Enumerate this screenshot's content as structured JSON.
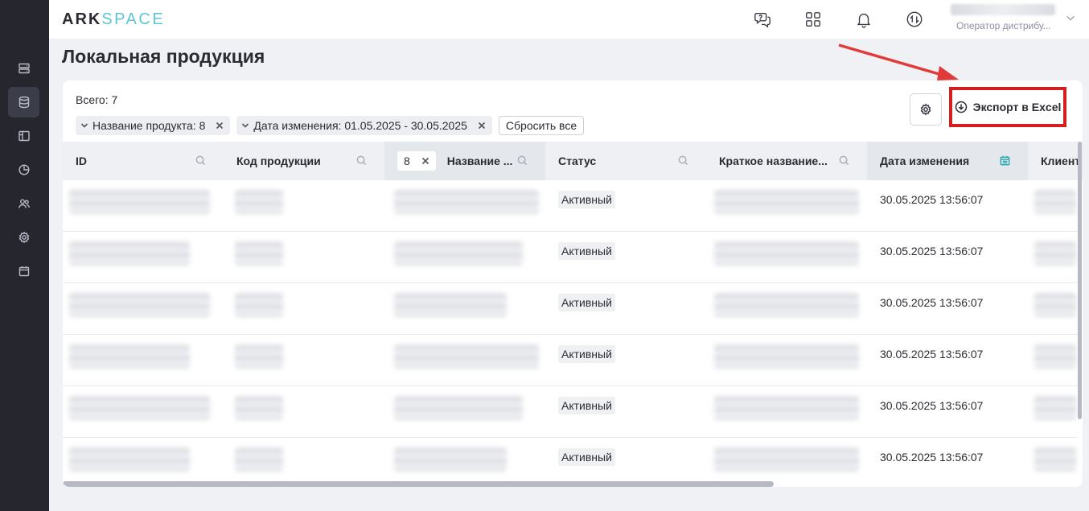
{
  "brand": {
    "part1": "ARK",
    "part2": "SPACE"
  },
  "header": {
    "icons": [
      "support-chat-icon",
      "apps-grid-icon",
      "bell-icon",
      "sync-icon"
    ],
    "user_role": "Оператор дистрибу..."
  },
  "sidebar": {
    "items": [
      {
        "icon": "servers-icon",
        "active": false
      },
      {
        "icon": "database-icon",
        "active": true
      },
      {
        "icon": "layout-icon",
        "active": false
      },
      {
        "icon": "pie-chart-icon",
        "active": false
      },
      {
        "icon": "users-icon",
        "active": false
      },
      {
        "icon": "settings-icon",
        "active": false
      },
      {
        "icon": "calendar-icon",
        "active": false
      }
    ]
  },
  "page": {
    "title": "Локальная продукция"
  },
  "toolbar": {
    "total": "Всего: 7",
    "filters": [
      {
        "label": "Название продукта: 8"
      },
      {
        "label": "Дата изменения: 01.05.2025 - 30.05.2025"
      }
    ],
    "reset_label": "Сбросить все",
    "export_label": "Экспорт в Excel"
  },
  "table": {
    "columns": [
      {
        "label": "ID",
        "icon": "search-icon"
      },
      {
        "label": "Код продукции",
        "icon": "search-icon"
      },
      {
        "label": "Название ...",
        "icon": "search-icon",
        "filter_value": "8"
      },
      {
        "label": "Статус",
        "icon": "search-icon"
      },
      {
        "label": "Краткое название...",
        "icon": "search-icon"
      },
      {
        "label": "Дата изменения",
        "icon": "calendar-icon"
      },
      {
        "label": "Клиент",
        "icon": ""
      }
    ],
    "rows": [
      {
        "status": "Активный",
        "date": "30.05.2025 13:56:07"
      },
      {
        "status": "Активный",
        "date": "30.05.2025 13:56:07"
      },
      {
        "status": "Активный",
        "date": "30.05.2025 13:56:07"
      },
      {
        "status": "Активный",
        "date": "30.05.2025 13:56:07"
      },
      {
        "status": "Активный",
        "date": "30.05.2025 13:56:07"
      },
      {
        "status": "Активный",
        "date": "30.05.2025 13:56:07"
      }
    ]
  },
  "colors": {
    "accent": "#5bc7d4",
    "highlight": "#d41f1f",
    "sidebar": "#25262e"
  }
}
